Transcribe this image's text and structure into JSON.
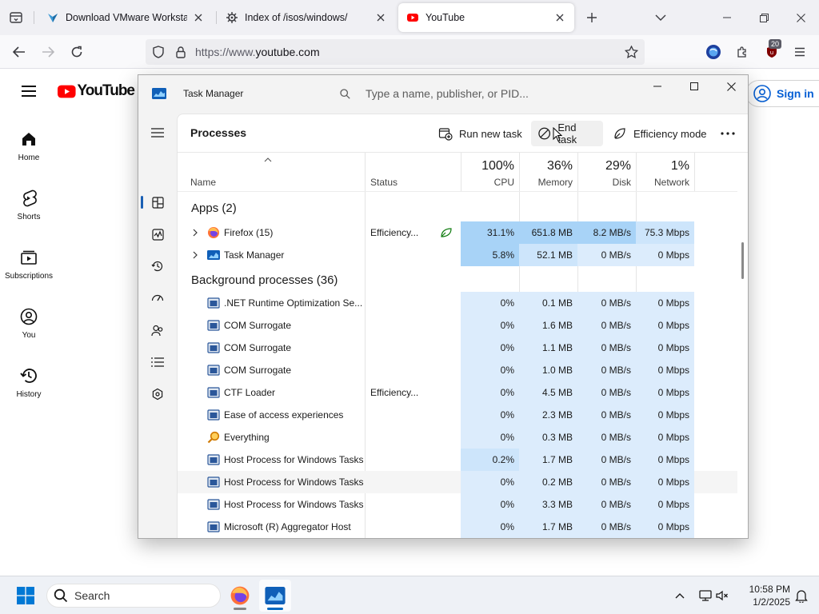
{
  "browser": {
    "tabs": [
      {
        "title": "Download VMware Workstation",
        "icon": "vmware-icon",
        "active": false
      },
      {
        "title": "Index of /isos/windows/",
        "icon": "page-gear-icon",
        "active": false
      },
      {
        "title": "YouTube",
        "icon": "youtube-icon",
        "active": true
      }
    ],
    "url_prefix": "https://www.",
    "url_domain": "youtube.com",
    "extension_badge": "20"
  },
  "youtube": {
    "logo_text": "YouTube",
    "nav": [
      {
        "label": "Home",
        "icon": "home-icon"
      },
      {
        "label": "Shorts",
        "icon": "shorts-icon"
      },
      {
        "label": "Subscriptions",
        "icon": "subscriptions-icon"
      },
      {
        "label": "You",
        "icon": "you-icon"
      },
      {
        "label": "History",
        "icon": "history-icon"
      }
    ],
    "signin_label": "Sign in"
  },
  "task_manager": {
    "title": "Task Manager",
    "search_placeholder": "Type a name, publisher, or PID...",
    "page_title": "Processes",
    "commands": {
      "run_new_task": "Run new task",
      "end_task": "End task",
      "efficiency_mode": "Efficiency mode"
    },
    "columns": {
      "name": "Name",
      "status": "Status",
      "cpu": {
        "label": "CPU",
        "pct": "100%"
      },
      "memory": {
        "label": "Memory",
        "pct": "36%"
      },
      "disk": {
        "label": "Disk",
        "pct": "29%"
      },
      "network": {
        "label": "Network",
        "pct": "1%"
      }
    },
    "groups": {
      "apps": "Apps (2)",
      "background": "Background processes (36)"
    },
    "apps": [
      {
        "name": "Firefox (15)",
        "status": "Efficiency...",
        "cpu": "31.1%",
        "memory": "651.8 MB",
        "disk": "8.2 MB/s",
        "network": "75.3 Mbps",
        "icon": "firefox-icon"
      },
      {
        "name": "Task Manager",
        "status": "",
        "cpu": "5.8%",
        "memory": "52.1 MB",
        "disk": "0 MB/s",
        "network": "0 Mbps",
        "icon": "taskmanager-icon"
      }
    ],
    "background": [
      {
        "name": ".NET Runtime Optimization Se...",
        "status": "",
        "cpu": "0%",
        "memory": "0.1 MB",
        "disk": "0 MB/s",
        "network": "0 Mbps"
      },
      {
        "name": "COM Surrogate",
        "status": "",
        "cpu": "0%",
        "memory": "1.6 MB",
        "disk": "0 MB/s",
        "network": "0 Mbps"
      },
      {
        "name": "COM Surrogate",
        "status": "",
        "cpu": "0%",
        "memory": "1.1 MB",
        "disk": "0 MB/s",
        "network": "0 Mbps"
      },
      {
        "name": "COM Surrogate",
        "status": "",
        "cpu": "0%",
        "memory": "1.0 MB",
        "disk": "0 MB/s",
        "network": "0 Mbps"
      },
      {
        "name": "CTF Loader",
        "status": "Efficiency...",
        "cpu": "0%",
        "memory": "4.5 MB",
        "disk": "0 MB/s",
        "network": "0 Mbps"
      },
      {
        "name": "Ease of access experiences",
        "status": "",
        "cpu": "0%",
        "memory": "2.3 MB",
        "disk": "0 MB/s",
        "network": "0 Mbps"
      },
      {
        "name": "Everything",
        "status": "",
        "cpu": "0%",
        "memory": "0.3 MB",
        "disk": "0 MB/s",
        "network": "0 Mbps"
      },
      {
        "name": "Host Process for Windows Tasks",
        "status": "",
        "cpu": "0.2%",
        "memory": "1.7 MB",
        "disk": "0 MB/s",
        "network": "0 Mbps"
      },
      {
        "name": "Host Process for Windows Tasks",
        "status": "",
        "cpu": "0%",
        "memory": "0.2 MB",
        "disk": "0 MB/s",
        "network": "0 Mbps"
      },
      {
        "name": "Host Process for Windows Tasks",
        "status": "",
        "cpu": "0%",
        "memory": "3.3 MB",
        "disk": "0 MB/s",
        "network": "0 Mbps"
      },
      {
        "name": "Microsoft (R) Aggregator Host",
        "status": "",
        "cpu": "0%",
        "memory": "1.7 MB",
        "disk": "0 MB/s",
        "network": "0 Mbps"
      }
    ]
  },
  "taskbar": {
    "search_label": "Search",
    "time": "10:58 PM",
    "date": "1/2/2025"
  },
  "colors": {
    "accent": "#0067c0",
    "youtube_red": "#ff0000",
    "heat_high": "#a8d3f7",
    "heat_low": "#dcecfc"
  }
}
